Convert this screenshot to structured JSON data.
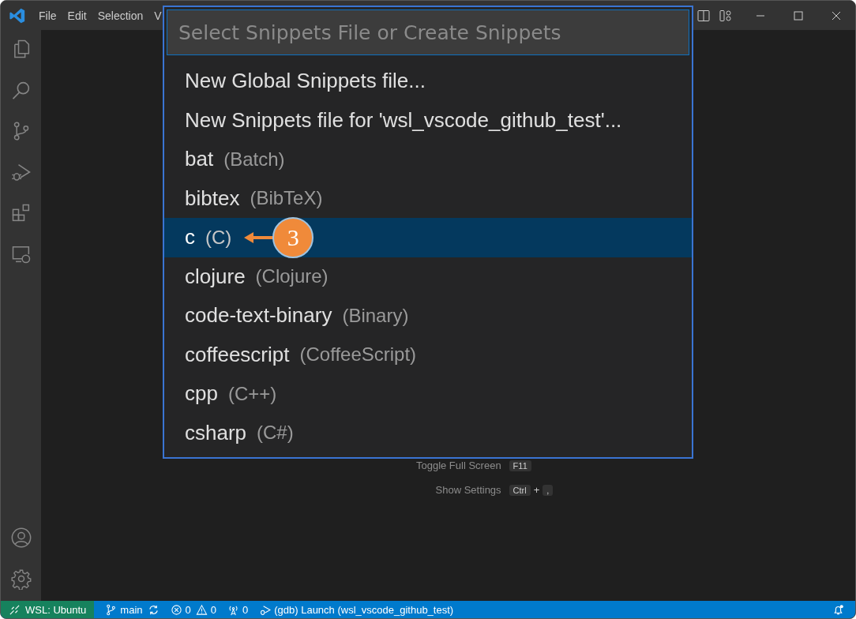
{
  "menu": [
    "File",
    "Edit",
    "Selection",
    "V"
  ],
  "quick_pick": {
    "placeholder": "Select Snippets File or Create Snippets",
    "items": [
      {
        "label": "New Global Snippets file...",
        "selected": false
      },
      {
        "label": "New Snippets file for 'wsl_vscode_github_test'...",
        "selected": false
      },
      {
        "label": "bat",
        "description": "(Batch)",
        "selected": false
      },
      {
        "label": "bibtex",
        "description": "(BibTeX)",
        "selected": false
      },
      {
        "label": "c",
        "description": "(C)",
        "selected": true,
        "callout": "3"
      },
      {
        "label": "clojure",
        "description": "(Clojure)",
        "selected": false
      },
      {
        "label": "code-text-binary",
        "description": "(Binary)",
        "selected": false
      },
      {
        "label": "coffeescript",
        "description": "(CoffeeScript)",
        "selected": false
      },
      {
        "label": "cpp",
        "description": "(C++)",
        "selected": false
      },
      {
        "label": "csharp",
        "description": "(C#)",
        "selected": false
      }
    ]
  },
  "hints": [
    {
      "label": "Toggle Full Screen",
      "keys": [
        "F11"
      ]
    },
    {
      "label": "Show Settings",
      "keys": [
        "Ctrl",
        ","
      ]
    }
  ],
  "key_joiner": "+",
  "status_bar": {
    "remote": "WSL: Ubuntu",
    "branch": "main",
    "errors": "0",
    "warnings": "0",
    "ports": "0",
    "debug": "(gdb) Launch (wsl_vscode_github_test)"
  }
}
